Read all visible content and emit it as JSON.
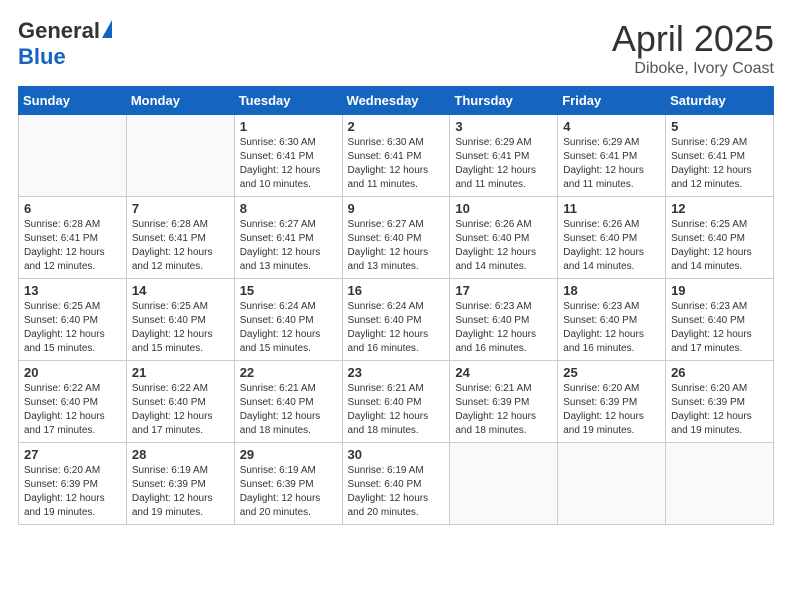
{
  "logo": {
    "general": "General",
    "blue": "Blue"
  },
  "title": "April 2025",
  "subtitle": "Diboke, Ivory Coast",
  "days_of_week": [
    "Sunday",
    "Monday",
    "Tuesday",
    "Wednesday",
    "Thursday",
    "Friday",
    "Saturday"
  ],
  "weeks": [
    [
      {
        "day": "",
        "info": ""
      },
      {
        "day": "",
        "info": ""
      },
      {
        "day": "1",
        "info": "Sunrise: 6:30 AM\nSunset: 6:41 PM\nDaylight: 12 hours and 10 minutes."
      },
      {
        "day": "2",
        "info": "Sunrise: 6:30 AM\nSunset: 6:41 PM\nDaylight: 12 hours and 11 minutes."
      },
      {
        "day": "3",
        "info": "Sunrise: 6:29 AM\nSunset: 6:41 PM\nDaylight: 12 hours and 11 minutes."
      },
      {
        "day": "4",
        "info": "Sunrise: 6:29 AM\nSunset: 6:41 PM\nDaylight: 12 hours and 11 minutes."
      },
      {
        "day": "5",
        "info": "Sunrise: 6:29 AM\nSunset: 6:41 PM\nDaylight: 12 hours and 12 minutes."
      }
    ],
    [
      {
        "day": "6",
        "info": "Sunrise: 6:28 AM\nSunset: 6:41 PM\nDaylight: 12 hours and 12 minutes."
      },
      {
        "day": "7",
        "info": "Sunrise: 6:28 AM\nSunset: 6:41 PM\nDaylight: 12 hours and 12 minutes."
      },
      {
        "day": "8",
        "info": "Sunrise: 6:27 AM\nSunset: 6:41 PM\nDaylight: 12 hours and 13 minutes."
      },
      {
        "day": "9",
        "info": "Sunrise: 6:27 AM\nSunset: 6:40 PM\nDaylight: 12 hours and 13 minutes."
      },
      {
        "day": "10",
        "info": "Sunrise: 6:26 AM\nSunset: 6:40 PM\nDaylight: 12 hours and 14 minutes."
      },
      {
        "day": "11",
        "info": "Sunrise: 6:26 AM\nSunset: 6:40 PM\nDaylight: 12 hours and 14 minutes."
      },
      {
        "day": "12",
        "info": "Sunrise: 6:25 AM\nSunset: 6:40 PM\nDaylight: 12 hours and 14 minutes."
      }
    ],
    [
      {
        "day": "13",
        "info": "Sunrise: 6:25 AM\nSunset: 6:40 PM\nDaylight: 12 hours and 15 minutes."
      },
      {
        "day": "14",
        "info": "Sunrise: 6:25 AM\nSunset: 6:40 PM\nDaylight: 12 hours and 15 minutes."
      },
      {
        "day": "15",
        "info": "Sunrise: 6:24 AM\nSunset: 6:40 PM\nDaylight: 12 hours and 15 minutes."
      },
      {
        "day": "16",
        "info": "Sunrise: 6:24 AM\nSunset: 6:40 PM\nDaylight: 12 hours and 16 minutes."
      },
      {
        "day": "17",
        "info": "Sunrise: 6:23 AM\nSunset: 6:40 PM\nDaylight: 12 hours and 16 minutes."
      },
      {
        "day": "18",
        "info": "Sunrise: 6:23 AM\nSunset: 6:40 PM\nDaylight: 12 hours and 16 minutes."
      },
      {
        "day": "19",
        "info": "Sunrise: 6:23 AM\nSunset: 6:40 PM\nDaylight: 12 hours and 17 minutes."
      }
    ],
    [
      {
        "day": "20",
        "info": "Sunrise: 6:22 AM\nSunset: 6:40 PM\nDaylight: 12 hours and 17 minutes."
      },
      {
        "day": "21",
        "info": "Sunrise: 6:22 AM\nSunset: 6:40 PM\nDaylight: 12 hours and 17 minutes."
      },
      {
        "day": "22",
        "info": "Sunrise: 6:21 AM\nSunset: 6:40 PM\nDaylight: 12 hours and 18 minutes."
      },
      {
        "day": "23",
        "info": "Sunrise: 6:21 AM\nSunset: 6:40 PM\nDaylight: 12 hours and 18 minutes."
      },
      {
        "day": "24",
        "info": "Sunrise: 6:21 AM\nSunset: 6:39 PM\nDaylight: 12 hours and 18 minutes."
      },
      {
        "day": "25",
        "info": "Sunrise: 6:20 AM\nSunset: 6:39 PM\nDaylight: 12 hours and 19 minutes."
      },
      {
        "day": "26",
        "info": "Sunrise: 6:20 AM\nSunset: 6:39 PM\nDaylight: 12 hours and 19 minutes."
      }
    ],
    [
      {
        "day": "27",
        "info": "Sunrise: 6:20 AM\nSunset: 6:39 PM\nDaylight: 12 hours and 19 minutes."
      },
      {
        "day": "28",
        "info": "Sunrise: 6:19 AM\nSunset: 6:39 PM\nDaylight: 12 hours and 19 minutes."
      },
      {
        "day": "29",
        "info": "Sunrise: 6:19 AM\nSunset: 6:39 PM\nDaylight: 12 hours and 20 minutes."
      },
      {
        "day": "30",
        "info": "Sunrise: 6:19 AM\nSunset: 6:40 PM\nDaylight: 12 hours and 20 minutes."
      },
      {
        "day": "",
        "info": ""
      },
      {
        "day": "",
        "info": ""
      },
      {
        "day": "",
        "info": ""
      }
    ]
  ]
}
